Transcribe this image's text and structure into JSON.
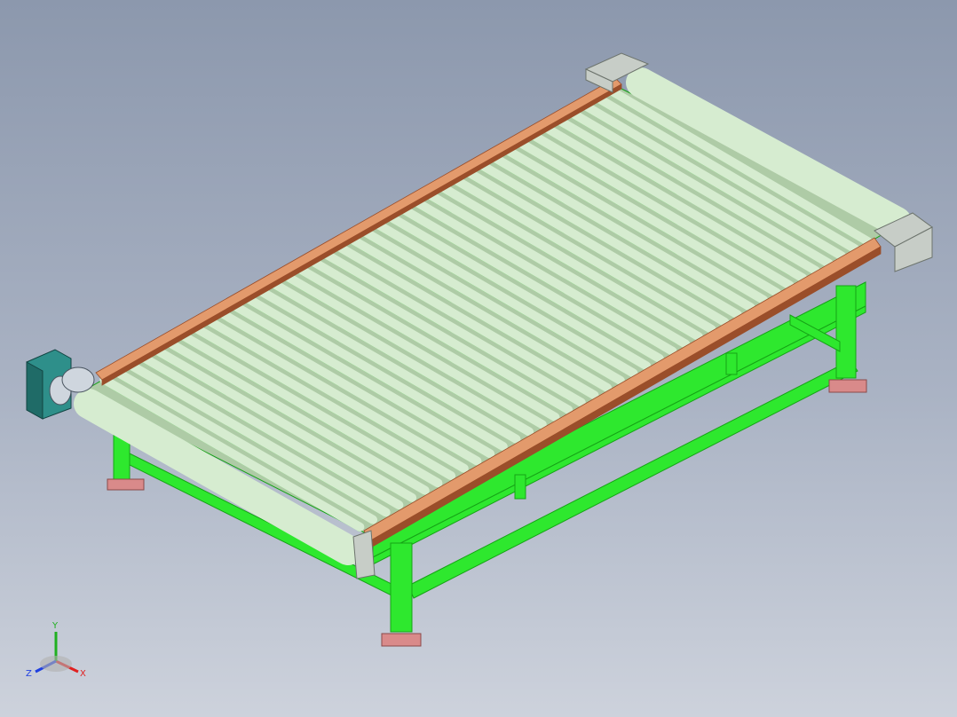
{
  "viewport": {
    "background_top": "#8c98ad",
    "background_bottom": "#cdd2dc"
  },
  "model": {
    "roller_count": 40,
    "colors": {
      "frame": "#2ee82e",
      "frame_dark": "#16a316",
      "roller": "#d6ecd0",
      "roller_shade": "#aecba6",
      "side_rail": "#e39a6c",
      "side_rail_dark": "#9a4e2a",
      "bearing_block": "#c7cdc7",
      "gearbox": "#2e8f8a",
      "foot_plate": "#d98a8a"
    }
  },
  "triad": {
    "x_label": "X",
    "y_label": "Y",
    "z_label": "Z",
    "x_color": "#e02020",
    "y_color": "#20b020",
    "z_color": "#2040e0"
  }
}
